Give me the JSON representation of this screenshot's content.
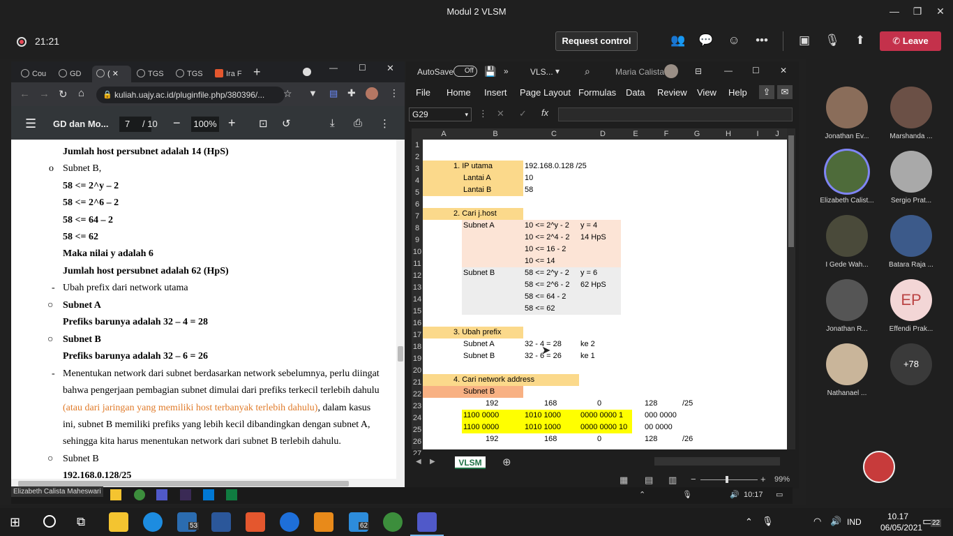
{
  "window": {
    "title": "Modul 2 VLSM"
  },
  "call": {
    "timer": "21:21",
    "request_control": "Request control",
    "leave": "Leave"
  },
  "chrome": {
    "tabs": [
      "Cou",
      "GD",
      "(",
      "TGS",
      "TGS",
      "Ira F"
    ],
    "url": "kuliah.uajy.ac.id/pluginfile.php/380396/...",
    "pdf_title": "GD dan Mo...",
    "page_current": "7",
    "page_total": "/ 10",
    "zoom": "100%"
  },
  "pdf": {
    "lines": [
      {
        "text": "Jumlah host persubnet adalah 14 (HpS)",
        "bold": true,
        "indent": 74,
        "bullet": ""
      },
      {
        "text": "Subnet B,",
        "bold": false,
        "indent": 74,
        "bullet": "o"
      },
      {
        "text": "58 <= 2^y – 2",
        "bold": true,
        "indent": 74,
        "bullet": ""
      },
      {
        "text": "58 <= 2^6 – 2",
        "bold": true,
        "indent": 74,
        "bullet": ""
      },
      {
        "text": "58 <= 64 – 2",
        "bold": true,
        "indent": 74,
        "bullet": ""
      },
      {
        "text": "58 <= 62",
        "bold": true,
        "indent": 74,
        "bullet": ""
      },
      {
        "text": "Maka nilai y adalah 6",
        "bold": true,
        "indent": 74,
        "bullet": ""
      },
      {
        "text": "Jumlah host persubnet adalah 62 (HpS)",
        "bold": true,
        "indent": 74,
        "bullet": ""
      },
      {
        "text": "Ubah prefix dari network utama",
        "bold": false,
        "indent": 74,
        "bullet": "-"
      },
      {
        "text": "Subnet A",
        "bold": true,
        "indent": 74,
        "bullet": "o"
      },
      {
        "text": "Prefiks barunya adalah 32 – 4 = 28",
        "bold": true,
        "indent": 74,
        "bullet": ""
      },
      {
        "text": "Subnet B",
        "bold": true,
        "indent": 74,
        "bullet": "o"
      },
      {
        "text": "Prefiks barunya adalah 32 – 6 = 26",
        "bold": true,
        "indent": 74,
        "bullet": ""
      }
    ],
    "para1": "Menentukan network dari subnet berdasarkan network sebelumnya, perlu diingat",
    "para2": "bahwa pengerjaan pembagian subnet dimulai dari prefiks terkecil terlebih dahulu",
    "para3_orange": "(atau dari jaringan yang memiliki host terbanyak terlebih dahulu)",
    "para3_rest": ", dalam kasus",
    "para4": "ini, subnet B memiliki prefiks yang lebih kecil dibandingkan dengan subnet A,",
    "para5": "sehingga kita harus menentukan network dari subnet B terlebih dahulu.",
    "last_bullet": "Subnet B",
    "last_line": "192.168.0.128/25"
  },
  "excel": {
    "autosave": "AutoSave",
    "autosave_state": "Off",
    "filename": "VLS...",
    "user": "Maria Calista",
    "menu": [
      "File",
      "Home",
      "Insert",
      "Page Layout",
      "Formulas",
      "Data",
      "Review",
      "View",
      "Help"
    ],
    "namebox": "G29",
    "fx": "fx",
    "columns": [
      "A",
      "B",
      "C",
      "D",
      "E",
      "F",
      "G",
      "H",
      "I",
      "J"
    ],
    "rows": [
      "1",
      "2",
      "3",
      "4",
      "5",
      "6",
      "7",
      "8",
      "9",
      "10",
      "11",
      "12",
      "13",
      "14",
      "15",
      "16",
      "17",
      "18",
      "19",
      "20",
      "21",
      "22",
      "23",
      "24",
      "25",
      "26",
      "27"
    ],
    "sheet": "VLSM",
    "zoom": "99%",
    "cells": {
      "r3b": "1.   IP utama",
      "r3c": "192.168.0.128  /25",
      "r4b": "Lantai A",
      "r4c": "10",
      "r5b": "Lantai B",
      "r5c": "58",
      "r7b": "2.   Cari j.host",
      "r8b": "Subnet A",
      "r8c": "10 <= 2^y - 2",
      "r8d": "y = 4",
      "r9c": "10 <= 2^4 - 2",
      "r9d": "14 HpS",
      "r10c": "10 <= 16 - 2",
      "r11c": "10 <= 14",
      "r12b": "Subnet B",
      "r12c": "58 <= 2^y - 2",
      "r12d": "y = 6",
      "r13c": "58 <= 2^6 - 2",
      "r13d": "62 HpS",
      "r14c": "58 <= 64 - 2",
      "r15c": "58 <= 62",
      "r17b": "3.   Ubah prefix",
      "r18b": "Subnet A",
      "r18c": "32 - 4 = 28",
      "r18d": "ke 2",
      "r19b": "Subnet B",
      "r19c": "32 - 6 = 26",
      "r19d": "ke 1",
      "r21b": "4.   Cari network address",
      "r22b": "Subnet B",
      "r23b": "192",
      "r23c": "168",
      "r23d": "0",
      "r23f": "128",
      "r23g": "/25",
      "r24b": "1100 0000",
      "r24c": "1010 1000",
      "r24d": "0000 0000  1",
      "r24f": "000 0000",
      "r25b": "1100 0000",
      "r25c": "1010 1000",
      "r25d": "0000 0000  10",
      "r25f": "00 0000",
      "r26b": "192",
      "r26c": "168",
      "r26d": "0",
      "r26f": "128",
      "r26g": "/26"
    }
  },
  "participants": [
    {
      "name": "Jonathan Ev...",
      "color": "#8a6d5a"
    },
    {
      "name": "Marshanda ...",
      "color": "#6b5046"
    },
    {
      "name": "Elizabeth Calist...",
      "color": "#4e6b3a"
    },
    {
      "name": "Sergio Prat...",
      "color": "#a9a9a9"
    },
    {
      "name": "I Gede Wah...",
      "color": "#4a4a3a"
    },
    {
      "name": "Batara Raja ...",
      "color": "#3c5a8a"
    },
    {
      "name": "Jonathan R...",
      "color": "#555555"
    },
    {
      "name": "Effendi Prak...",
      "initials": "EP",
      "color": "#f3d6d6"
    },
    {
      "name": "Nathanael ...",
      "color": "#c9b59a"
    },
    {
      "name": "+78",
      "color": "#3a3a3a"
    }
  ],
  "presenter_label": "Elizabeth Calista Maheswari",
  "remote_taskbar": {
    "time": "10:17"
  },
  "taskbar": {
    "badges": {
      "mail": "53",
      "files": "62",
      "notif": "22"
    },
    "lang": "IND",
    "time": "10.17",
    "date": "06/05/2021"
  }
}
